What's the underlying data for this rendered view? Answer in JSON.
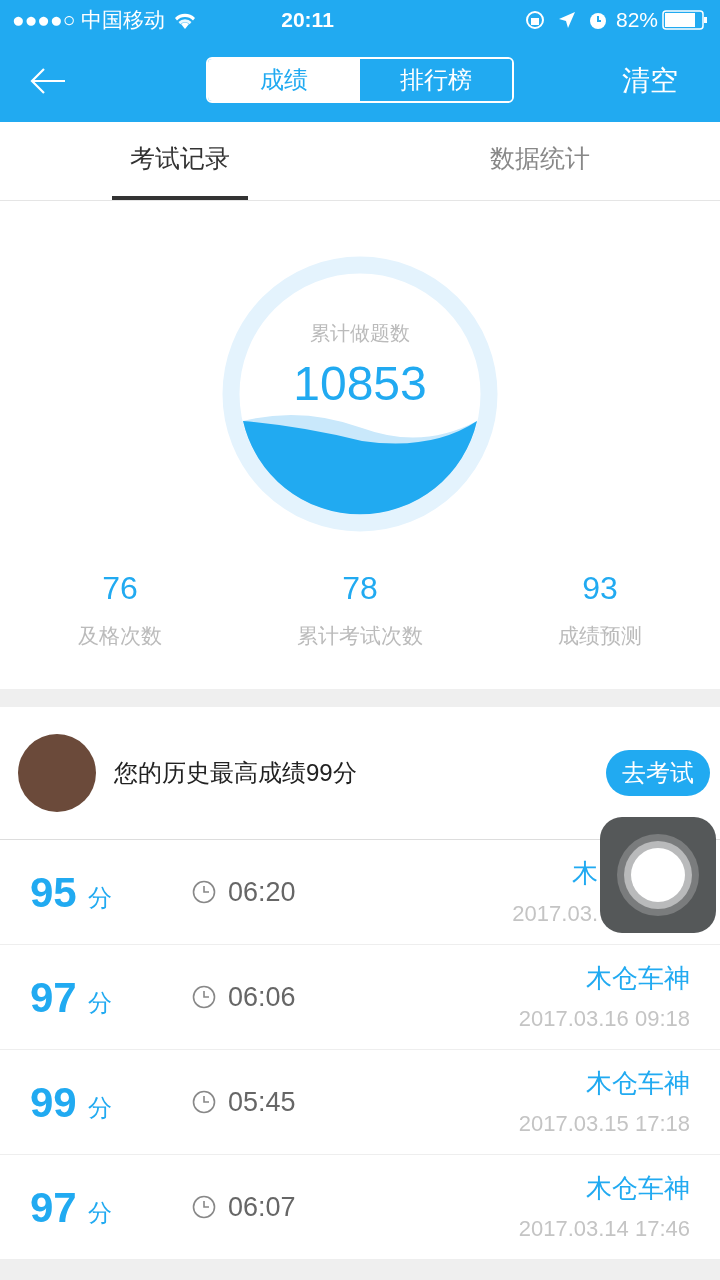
{
  "status_bar": {
    "carrier": "●●●●○ 中国移动",
    "time": "20:11",
    "battery": "82%"
  },
  "header": {
    "segments": [
      {
        "label": "成绩",
        "selected": true
      },
      {
        "label": "排行榜",
        "selected": false
      }
    ],
    "action": "清空"
  },
  "tabs": [
    {
      "label": "考试记录",
      "selected": true
    },
    {
      "label": "数据统计",
      "selected": false
    }
  ],
  "summary": {
    "label": "累计做题数",
    "value": "10853"
  },
  "stats": [
    {
      "value": "76",
      "label": "及格次数"
    },
    {
      "value": "78",
      "label": "累计考试次数"
    },
    {
      "value": "93",
      "label": "成绩预测"
    }
  ],
  "best": {
    "text": "您的历史最高成绩99分",
    "button": "去考试"
  },
  "records": [
    {
      "score": "95",
      "unit": "分",
      "duration": "06:20",
      "name": "木",
      "date": "2017.03."
    },
    {
      "score": "97",
      "unit": "分",
      "duration": "06:06",
      "name": "木仓车神",
      "date": "2017.03.16 09:18"
    },
    {
      "score": "99",
      "unit": "分",
      "duration": "05:45",
      "name": "木仓车神",
      "date": "2017.03.15 17:18"
    },
    {
      "score": "97",
      "unit": "分",
      "duration": "06:07",
      "name": "木仓车神",
      "date": "2017.03.14 17:46"
    }
  ]
}
